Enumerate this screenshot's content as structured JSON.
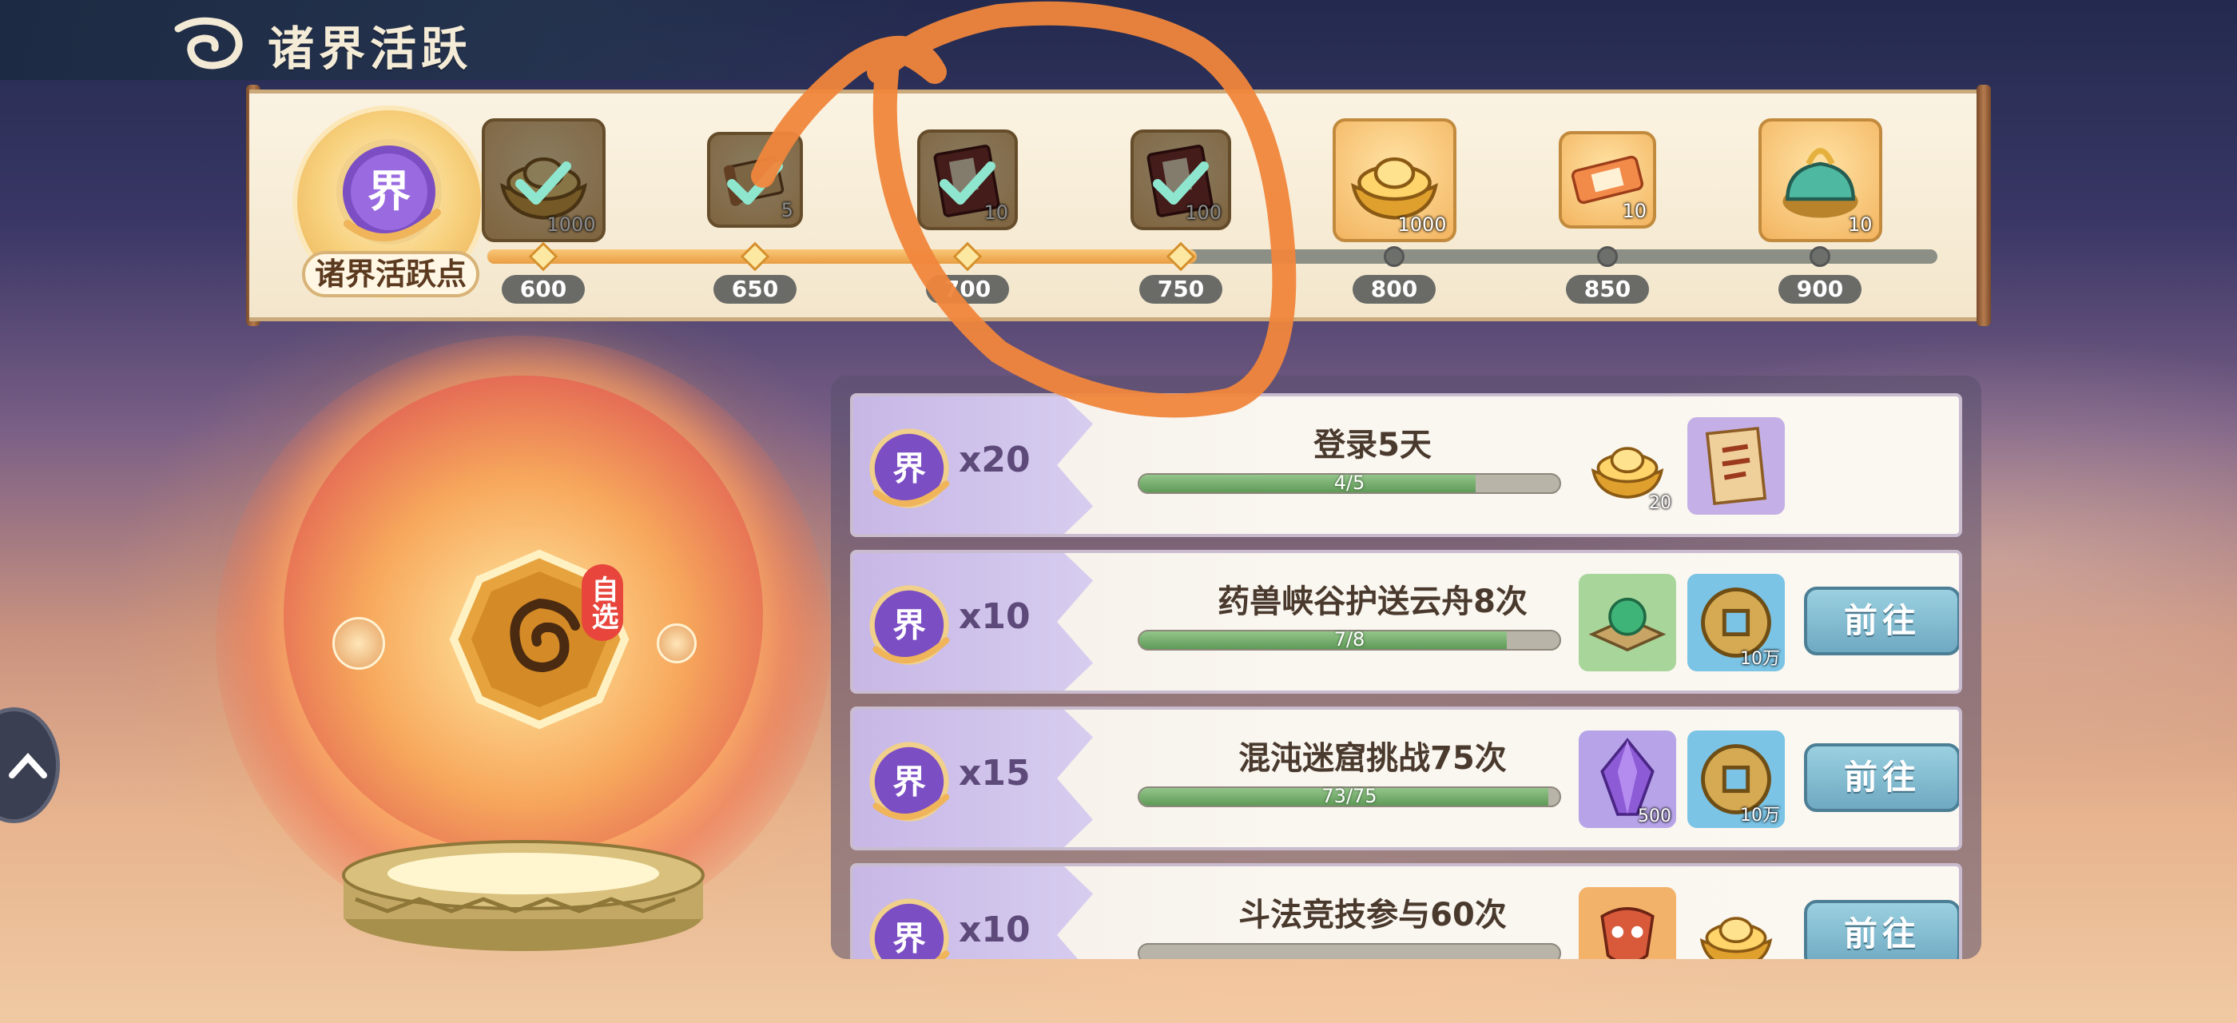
{
  "header": {
    "title": "诸界活跃"
  },
  "points": {
    "label": "诸界活跃点",
    "coin_glyph": "界"
  },
  "milestones": [
    {
      "threshold": "600",
      "count": "1000",
      "claimed": true,
      "item": "gold-ingot"
    },
    {
      "threshold": "650",
      "count": "5",
      "claimed": true,
      "item": "scroll"
    },
    {
      "threshold": "700",
      "count": "10",
      "claimed": true,
      "item": "book"
    },
    {
      "threshold": "750",
      "count": "100",
      "claimed": true,
      "item": "book"
    },
    {
      "threshold": "800",
      "count": "1000",
      "claimed": false,
      "item": "gold-ingot"
    },
    {
      "threshold": "850",
      "count": "10",
      "claimed": false,
      "item": "ticket"
    },
    {
      "threshold": "900",
      "count": "10",
      "claimed": false,
      "item": "jade-chest"
    }
  ],
  "progress": {
    "reached_milestone_index": 3
  },
  "chest": {
    "badge": "自选"
  },
  "tasks": [
    {
      "points": "x20",
      "title": "登录5天",
      "progress_text": "4/5",
      "progress": 0.8,
      "rewards": [
        {
          "item": "gold-ingot",
          "count": "20"
        },
        {
          "item": "refresh-scroll",
          "count": ""
        }
      ],
      "go_label": ""
    },
    {
      "points": "x10",
      "title": "药兽峡谷护送云舟8次",
      "progress_text": "7/8",
      "progress": 0.875,
      "rewards": [
        {
          "item": "jade-orb",
          "count": ""
        },
        {
          "item": "copper-coin",
          "count": "10万"
        }
      ],
      "go_label": "前往"
    },
    {
      "points": "x15",
      "title": "混沌迷窟挑战75次",
      "progress_text": "73/75",
      "progress": 0.973,
      "rewards": [
        {
          "item": "purple-crystal",
          "count": "500"
        },
        {
          "item": "copper-coin",
          "count": "10万"
        }
      ],
      "go_label": "前往"
    },
    {
      "points": "x10",
      "title": "斗法竞技参与60次",
      "progress_text": "",
      "progress": 0,
      "rewards": [
        {
          "item": "mask",
          "count": ""
        },
        {
          "item": "gold-ingot",
          "count": ""
        }
      ],
      "go_label": "前往"
    }
  ],
  "colors": {
    "accent_orange": "#f0863c",
    "progress_green": "#5f9a57",
    "go_button": "#6fa9c2"
  }
}
